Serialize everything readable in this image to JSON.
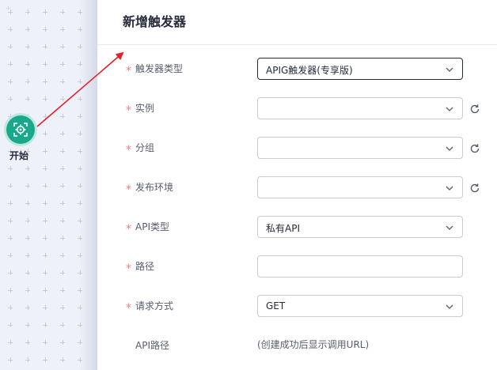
{
  "canvas": {
    "start_node_label": "开始"
  },
  "panel": {
    "title": "新增触发器",
    "fields": [
      {
        "label": "触发器类型",
        "required": true,
        "value": "APIG触发器(专享版)",
        "type": "select",
        "active": true,
        "refresh": false
      },
      {
        "label": "实例",
        "required": true,
        "value": "",
        "type": "select",
        "active": false,
        "refresh": true
      },
      {
        "label": "分组",
        "required": true,
        "value": "",
        "type": "select",
        "active": false,
        "refresh": true
      },
      {
        "label": "发布环境",
        "required": true,
        "value": "",
        "type": "select",
        "active": false,
        "refresh": true
      },
      {
        "label": "API类型",
        "required": true,
        "value": "私有API",
        "type": "select",
        "active": false,
        "refresh": false
      },
      {
        "label": "路径",
        "required": true,
        "value": "",
        "type": "input",
        "active": false,
        "refresh": false
      },
      {
        "label": "请求方式",
        "required": true,
        "value": "GET",
        "type": "select",
        "active": false,
        "refresh": false
      }
    ],
    "api_path": {
      "label": "API路径",
      "value": "(创建成功后显示调用URL)"
    },
    "required_mark": "*"
  },
  "colors": {
    "accent_green": "#1aa88a",
    "required_red": "#e8838b",
    "arrow_red": "#e5202a"
  }
}
